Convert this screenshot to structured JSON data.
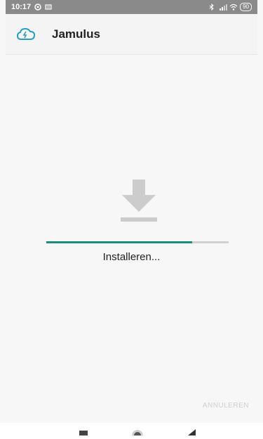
{
  "status_bar": {
    "time": "10:17",
    "battery": "90"
  },
  "app_bar": {
    "title": "Jamulus"
  },
  "install": {
    "progress": 0.8,
    "status_text": "Installeren...",
    "cancel_label": "ANNULEREN"
  },
  "colors": {
    "accent": "#1a8e7c",
    "status_bar": "#8a8a8a",
    "icon": "#cccccc"
  },
  "icons": {
    "app": "cloud-icon",
    "download": "download-icon",
    "nav_recents": "square-icon",
    "nav_home": "circle-icon",
    "nav_back": "triangle-icon"
  }
}
